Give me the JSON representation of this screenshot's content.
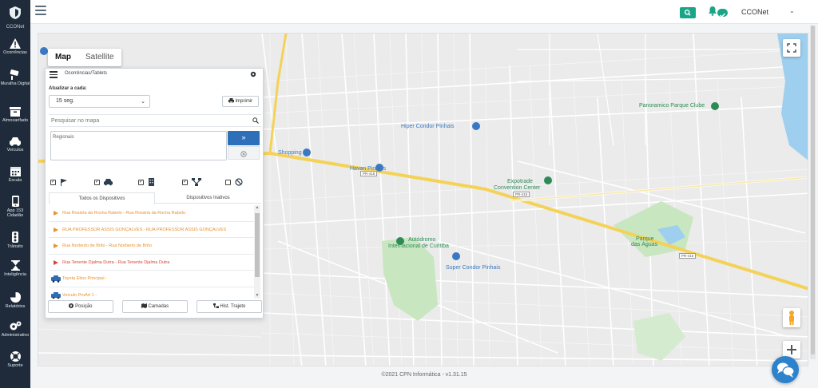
{
  "sidebar": {
    "logo_label": "CCONet",
    "items": [
      {
        "label": "Ocorrências",
        "icon": "alert-icon"
      },
      {
        "label": "Muralha Digital",
        "icon": "camera-icon"
      },
      {
        "label": "Almoxarifado",
        "icon": "archive-icon"
      },
      {
        "label": "Veículos",
        "icon": "car-icon"
      },
      {
        "label": "Escala",
        "icon": "calendar-icon"
      },
      {
        "label": "App 153 Cidadão",
        "icon": "phone-icon"
      },
      {
        "label": "Trânsito",
        "icon": "traffic-light-icon"
      },
      {
        "label": "Inteligência",
        "icon": "hourglass-icon"
      },
      {
        "label": "Relatórios",
        "icon": "pie-chart-icon"
      },
      {
        "label": "Administrativo",
        "icon": "cogs-icon"
      },
      {
        "label": "Suporte",
        "icon": "lifebuoy-icon"
      }
    ]
  },
  "topbar": {
    "user_name": "CCONet",
    "caret": "⌄"
  },
  "map": {
    "tabs": [
      "Map",
      "Satellite"
    ],
    "labels": [
      {
        "text": "Hiper Condor Pinhais",
        "kind": "blue"
      },
      {
        "text": "Panoramico Parque Clube",
        "kind": "green"
      },
      {
        "text": "Havan Pinhais",
        "kind": "blue"
      },
      {
        "text": "Expotrade",
        "kind": "green"
      },
      {
        "text": "Convention Center",
        "kind": "green"
      },
      {
        "text": "Shopping",
        "kind": "blue"
      },
      {
        "text": "Autódromo",
        "kind": "green"
      },
      {
        "text": "Internacional de Curitiba",
        "kind": "green"
      },
      {
        "text": "Super Condor Pinhais",
        "kind": "blue"
      },
      {
        "text": "Parque",
        "kind": "green"
      },
      {
        "text": "das Águas",
        "kind": "green"
      }
    ],
    "highway_tags": [
      "PR-415",
      "PR-415",
      "PR-415"
    ]
  },
  "panel": {
    "title": "Ocorrências/Tablets",
    "update_label": "Atualizar a cada:",
    "interval": "15 seg.",
    "print_label": "Imprimir",
    "search_placeholder": "Pesquisar no mapa",
    "regionais_placeholder": "Regionais",
    "go_symbol": "»",
    "tabs": [
      "Todos os Dispositivos",
      "Dispositivos Inativos"
    ],
    "devices": [
      {
        "label": "Rua Rosária da Rocha Rabelo - Rua Rosária da Rocha Rabelo",
        "color": "orange"
      },
      {
        "label": "RUA PROFESSOR ASSIS GONÇALVES - RUA PROFESSOR ASSIS GONÇALVES",
        "color": "orange"
      },
      {
        "label": "Rua Norberto de Brito - Rua Norberto de Brito",
        "color": "orange"
      },
      {
        "label": "Rua Tenente Djalma Dutra - Rua Tenente Djalma Dutra",
        "color": "red"
      },
      {
        "label": "Toyota Etios Principal -",
        "color": "orange",
        "vehicle": true
      },
      {
        "label": "Veículo ProArt 1 -",
        "color": "orange",
        "vehicle": true
      }
    ],
    "buttons": [
      "Posição",
      "Camadas",
      "Hist. Trajeto"
    ]
  },
  "footer": "©2021 CPN Informática - v1.31.15",
  "colors": {
    "sidebar_bg": "#1f2b3a",
    "accent_green": "#1aa589",
    "accent_blue": "#2d6fb8",
    "highway": "#f4d257"
  }
}
